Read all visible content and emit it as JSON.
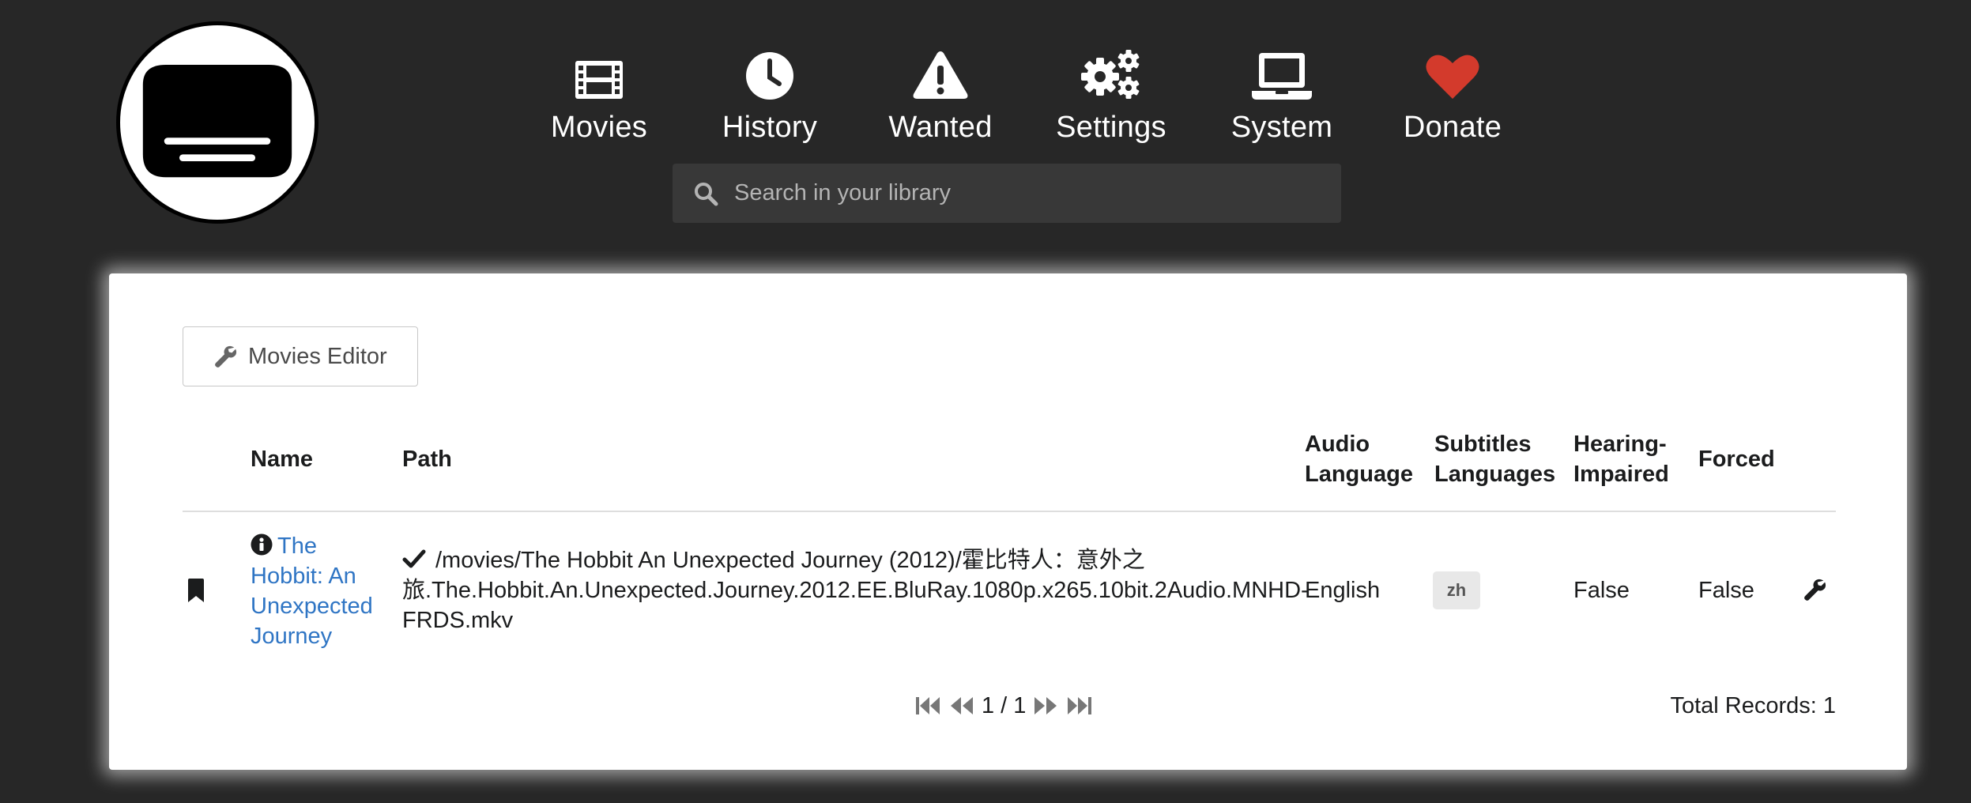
{
  "nav": {
    "items": [
      {
        "label": "Movies",
        "icon": "film-icon"
      },
      {
        "label": "History",
        "icon": "clock-icon"
      },
      {
        "label": "Wanted",
        "icon": "warning-icon"
      },
      {
        "label": "Settings",
        "icon": "gears-icon"
      },
      {
        "label": "System",
        "icon": "laptop-icon"
      },
      {
        "label": "Donate",
        "icon": "heart-icon"
      }
    ]
  },
  "search": {
    "placeholder": "Search in your library"
  },
  "toolbar": {
    "editor_label": "Movies Editor"
  },
  "table": {
    "headers": {
      "name": "Name",
      "path": "Path",
      "audio_line1": "Audio",
      "audio_line2": "Language",
      "subs_line1": "Subtitles",
      "subs_line2": "Languages",
      "hi_line1": "Hearing-",
      "hi_line2": "Impaired",
      "forced": "Forced"
    },
    "rows": [
      {
        "name": "The Hobbit: An Unexpected Journey",
        "path_line1": "/movies/The Hobbit An Unexpected Journey (2012)/霍比特人：意外之",
        "path_line2": "旅.The.Hobbit.An.Unexpected.Journey.2012.EE.BluRay.1080p.x265.10bit.2Audio.MNHD-",
        "path_line3": "FRDS.mkv",
        "audio_language": "English",
        "subtitles": "zh",
        "hearing_impaired": "False",
        "forced": "False"
      }
    ]
  },
  "pagination": {
    "page_text": "1 / 1",
    "total_text": "Total Records: 1"
  },
  "colors": {
    "background": "#272727",
    "link": "#2f75c4",
    "heart": "#d33a2c"
  }
}
